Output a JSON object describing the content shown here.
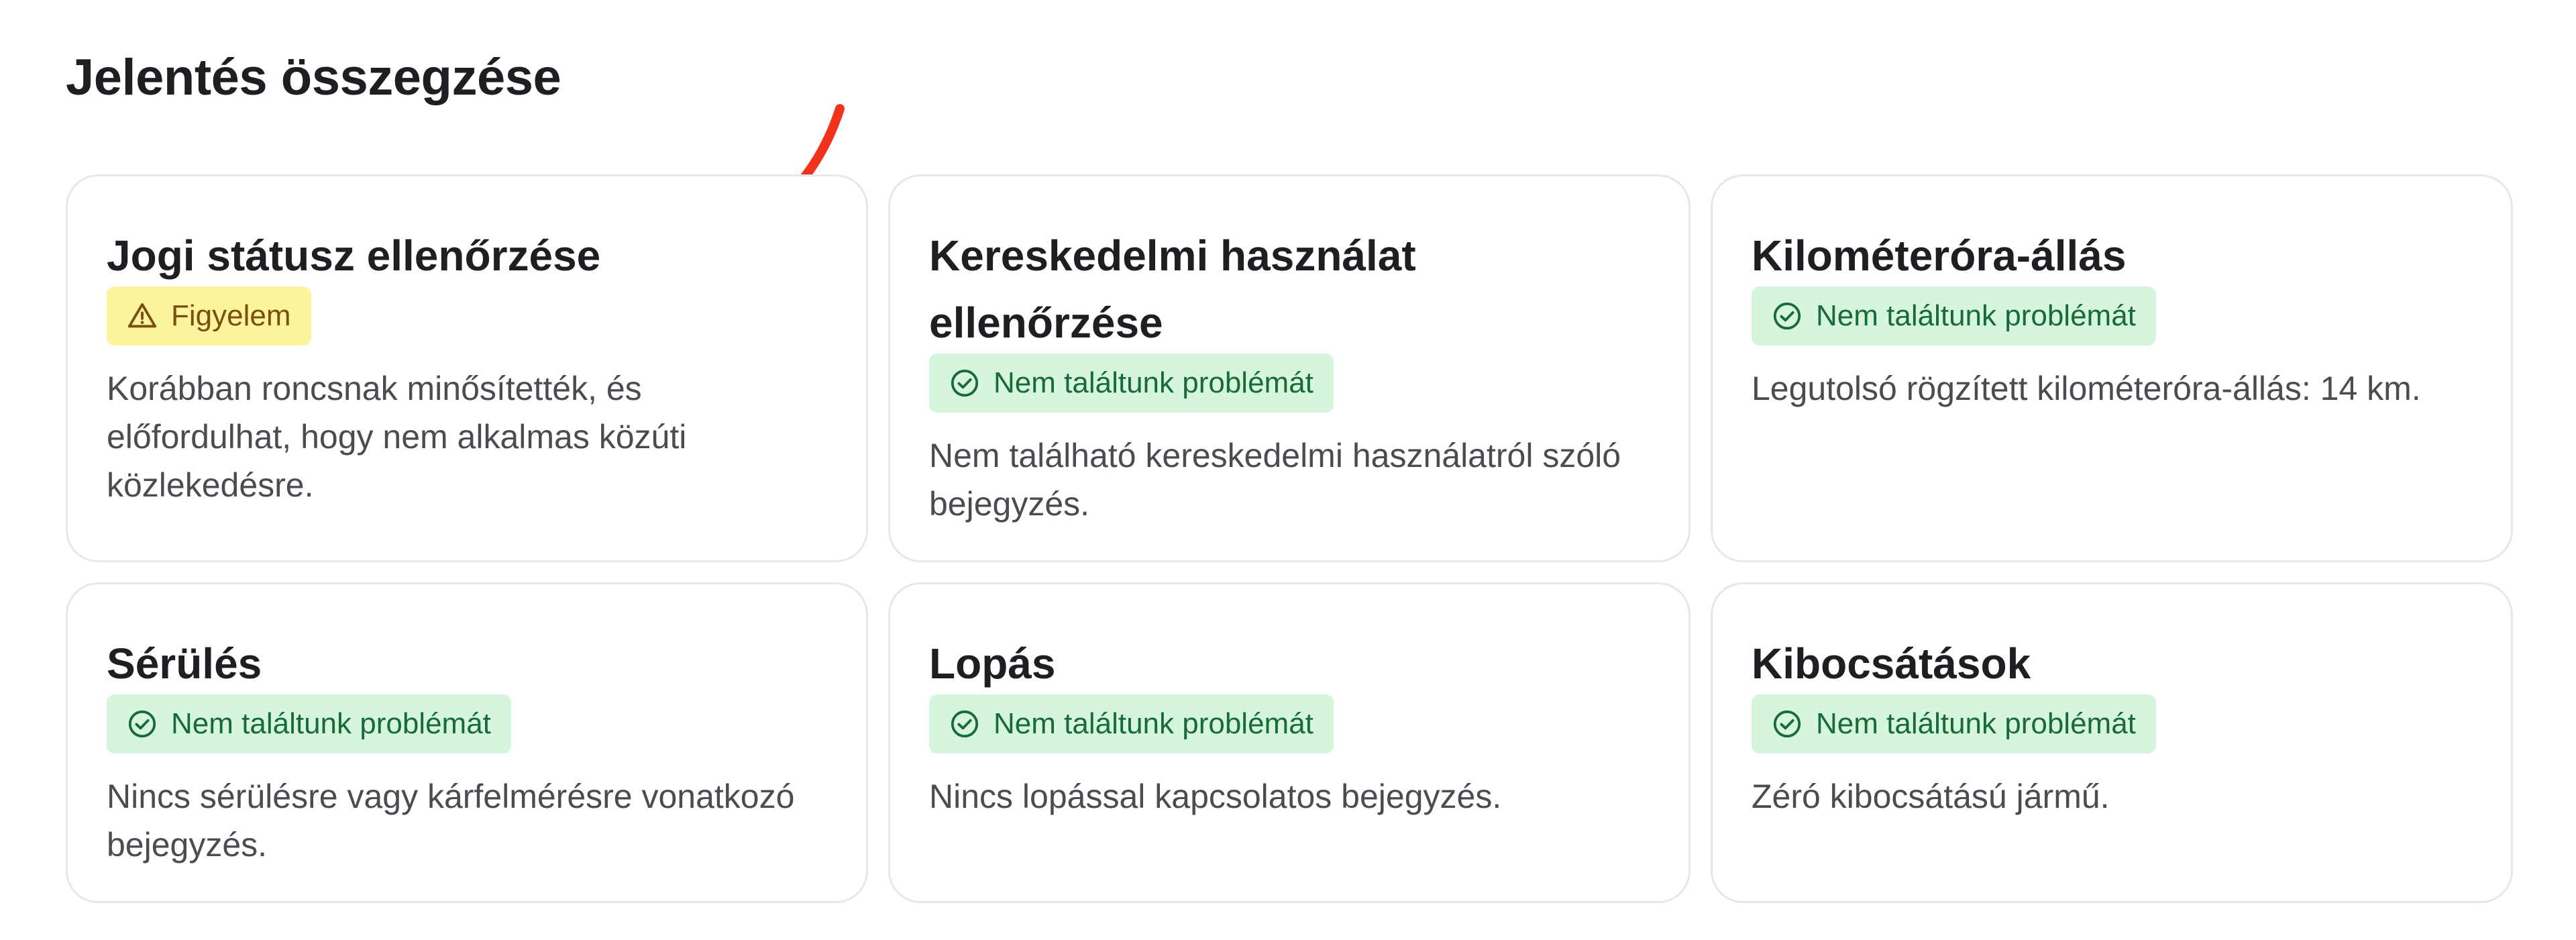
{
  "page": {
    "title": "Jelentés összegzése"
  },
  "colors": {
    "warning_bg": "#fef49e",
    "warning_text": "#7a4e0c",
    "ok_bg": "#d5f6dd",
    "ok_text": "#186a3a",
    "arrow": "#f2331b"
  },
  "cards": [
    {
      "title": "Jogi státusz ellenőrzése",
      "badge": {
        "label": "Figyelem",
        "status": "warning",
        "icon": "warning-triangle-icon"
      },
      "description": "Korábban roncsnak minősítették, és előfordulhat, hogy nem alkalmas közúti közlekedésre."
    },
    {
      "title": "Kereskedelmi használat ellenőrzése",
      "badge": {
        "label": "Nem találtunk problémát",
        "status": "ok",
        "icon": "check-circle-icon"
      },
      "description": "Nem található kereskedelmi használatról szóló bejegyzés."
    },
    {
      "title": "Kilométeróra-állás",
      "badge": {
        "label": "Nem találtunk problémát",
        "status": "ok",
        "icon": "check-circle-icon"
      },
      "description": "Legutolsó rögzített kilométeróra-állás: 14 km."
    },
    {
      "title": "Sérülés",
      "badge": {
        "label": "Nem találtunk problémát",
        "status": "ok",
        "icon": "check-circle-icon"
      },
      "description": "Nincs sérülésre vagy kárfelmérésre vonatkozó bejegyzés."
    },
    {
      "title": "Lopás",
      "badge": {
        "label": "Nem találtunk problémát",
        "status": "ok",
        "icon": "check-circle-icon"
      },
      "description": "Nincs lopással kapcsolatos bejegyzés."
    },
    {
      "title": "Kibocsátások",
      "badge": {
        "label": "Nem találtunk problémát",
        "status": "ok",
        "icon": "check-circle-icon"
      },
      "description": "Zéró kibocsátású jármű."
    }
  ]
}
